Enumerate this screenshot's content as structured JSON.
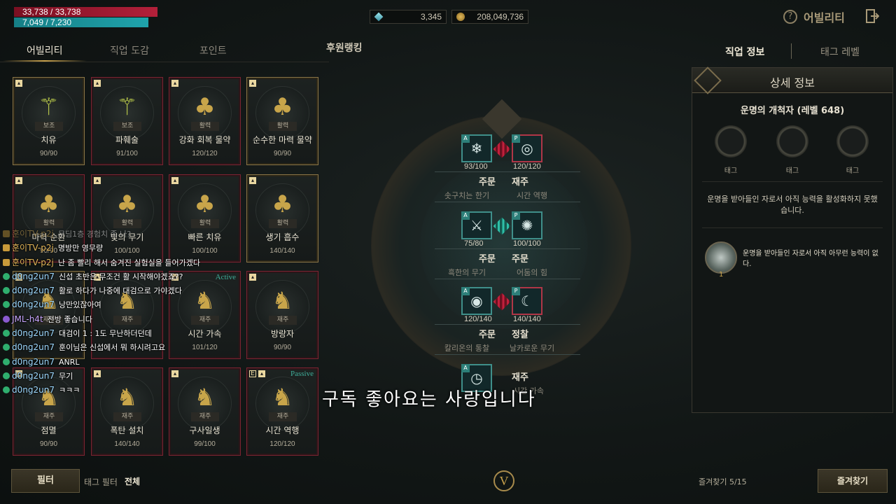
{
  "status": {
    "hp": "33,738 / 33,738",
    "mp": "7,049 / 7,230"
  },
  "currency": {
    "gems": "3,345",
    "gold": "208,049,736"
  },
  "header": {
    "title": "어빌리티"
  },
  "tabs": [
    "어빌리티",
    "직업 도감",
    "포인트",
    "후원랭킹"
  ],
  "right_tabs": [
    "직업 정보",
    "태그 레벨"
  ],
  "cards": [
    {
      "cat": "보조",
      "name": "치유",
      "lvl": "90/90",
      "glyph": "⚚",
      "color": "#b8c84a",
      "style": "gold"
    },
    {
      "cat": "보조",
      "name": "파훼술",
      "lvl": "91/100",
      "glyph": "⚚",
      "color": "#b8c84a",
      "style": "red"
    },
    {
      "cat": "활력",
      "name": "강화 회복 물약",
      "lvl": "120/120",
      "glyph": "♣",
      "color": "#c8a54a",
      "style": "red"
    },
    {
      "cat": "활력",
      "name": "순수한 마력 물약",
      "lvl": "90/90",
      "glyph": "♣",
      "color": "#c8a54a",
      "style": "gold"
    },
    {
      "cat": "활력",
      "name": "마력 순환",
      "lvl": "90/90",
      "glyph": "♣",
      "color": "#c8a54a",
      "style": "red"
    },
    {
      "cat": "활력",
      "name": "빛의 무기",
      "lvl": "100/100",
      "glyph": "♣",
      "color": "#c8a54a",
      "style": "red"
    },
    {
      "cat": "활력",
      "name": "빠른 치유",
      "lvl": "100/100",
      "glyph": "♣",
      "color": "#c8a54a",
      "style": "red"
    },
    {
      "cat": "활력",
      "name": "생기 흡수",
      "lvl": "140/140",
      "glyph": "♣",
      "color": "#c8a54a",
      "style": "gold"
    },
    {
      "cat": "재주",
      "name": "",
      "lvl": "",
      "glyph": "♞",
      "color": "#c8a54a",
      "style": "gold"
    },
    {
      "cat": "재주",
      "name": "",
      "lvl": "",
      "glyph": "♞",
      "color": "#c8a54a",
      "style": "red"
    },
    {
      "cat": "재주",
      "name": "시간 가속",
      "lvl": "101/120",
      "glyph": "♞",
      "color": "#c8a54a",
      "style": "red",
      "badge": "Active"
    },
    {
      "cat": "재주",
      "name": "방랑자",
      "lvl": "90/90",
      "glyph": "♞",
      "color": "#c8a54a",
      "style": "red"
    },
    {
      "cat": "재주",
      "name": "점멸",
      "lvl": "90/90",
      "glyph": "♞",
      "color": "#c8a54a",
      "style": "red"
    },
    {
      "cat": "재주",
      "name": "폭탄 설치",
      "lvl": "140/140",
      "glyph": "♞",
      "color": "#c8a54a",
      "style": "red"
    },
    {
      "cat": "재주",
      "name": "구사일생",
      "lvl": "99/100",
      "glyph": "♞",
      "color": "#c8a54a",
      "style": "red"
    },
    {
      "cat": "재주",
      "name": "시간 역행",
      "lvl": "120/120",
      "glyph": "♞",
      "color": "#c8a54a",
      "style": "red",
      "badge": "Passive",
      "e": "E"
    }
  ],
  "chat": [
    {
      "user": "훈이TV-p2j",
      "msg": "무딤1층 경험치 좀 나?",
      "faded": true,
      "kind": "gold"
    },
    {
      "user": "훈이TV-p2j",
      "msg": "명방만 영무량",
      "faded": false,
      "kind": "gold"
    },
    {
      "user": "훈이TV-p2j",
      "msg": "난 좀 빨리 해서 숨겨진 실험실을 들어가겠다",
      "faded": false,
      "kind": "gold"
    },
    {
      "user": "d0ng2un7",
      "msg": "신섭 초반은 무조건 활 시작해야겠죠??",
      "faded": false,
      "kind": "green"
    },
    {
      "user": "d0ng2un7",
      "msg": "활로 하다가 나중에 대검으로 가야겠다",
      "faded": false,
      "kind": "green"
    },
    {
      "user": "d0ng2un7",
      "msg": "낭만있잖아여",
      "faded": false,
      "kind": "green"
    },
    {
      "user": "JML-h4t",
      "msg": "전방 좋습니다",
      "faded": false,
      "kind": "purple"
    },
    {
      "user": "d0ng2un7",
      "msg": "대검이 1 : 1도 무난하더던데",
      "faded": false,
      "kind": "green"
    },
    {
      "user": "d0ng2un7",
      "msg": "훈이님은 신섭에서 뭐 하시려고요",
      "faded": false,
      "kind": "green"
    },
    {
      "user": "d0ng2un7",
      "msg": "ANRL",
      "faded": false,
      "kind": "green"
    },
    {
      "user": "d0ng2un7",
      "msg": "무기",
      "faded": false,
      "kind": "green"
    },
    {
      "user": "d0ng2un7",
      "msg": "ㅋㅋㅋ",
      "faded": false,
      "kind": "green"
    }
  ],
  "tree": {
    "rows": [
      {
        "left_lvl": "93/100",
        "right_lvl": "120/120",
        "left_title": "주문",
        "right_title": "재주",
        "left_sub": "솟구치는 한기",
        "right_sub": "시간 역행",
        "link": "red",
        "left_sym": "❄",
        "right_sym": "◎"
      },
      {
        "left_lvl": "75/80",
        "right_lvl": "100/100",
        "left_title": "주문",
        "right_title": "주문",
        "left_sub": "흑한의 무기",
        "right_sub": "어둠의 힘",
        "link": "teal",
        "left_sym": "⚔",
        "right_sym": "✺"
      },
      {
        "left_lvl": "120/140",
        "right_lvl": "140/140",
        "left_title": "주문",
        "right_title": "정찰",
        "left_sub": "칼리온의 통찰",
        "right_sub": "날카로운 무기",
        "link": "red",
        "left_sym": "◉",
        "right_sym": "☾"
      }
    ],
    "bottom": {
      "title": "재주",
      "sub": "시간 가속",
      "sym": "◷"
    }
  },
  "subtitle": "구독 좋아요는 사랑입니다",
  "panel": {
    "title": "상세 정보",
    "class_name": "운명의 개척자 (레벨 648)",
    "tags": [
      "태그",
      "태그",
      "태그"
    ],
    "desc": "운명을 받아들인 자로서 아직 능력을 활성화하지 못했습니다.",
    "mini_text": "운명을 받아들인 자로서 아직 아무런 능력이 없다.",
    "mini_count": "1"
  },
  "bottom": {
    "filter": "필터",
    "tag_filter": "태그 필터",
    "tag_filter_value": "전체",
    "emblem": "V",
    "fav_count": "즐겨찾기 5/15",
    "fav_button": "즐겨찾기"
  }
}
